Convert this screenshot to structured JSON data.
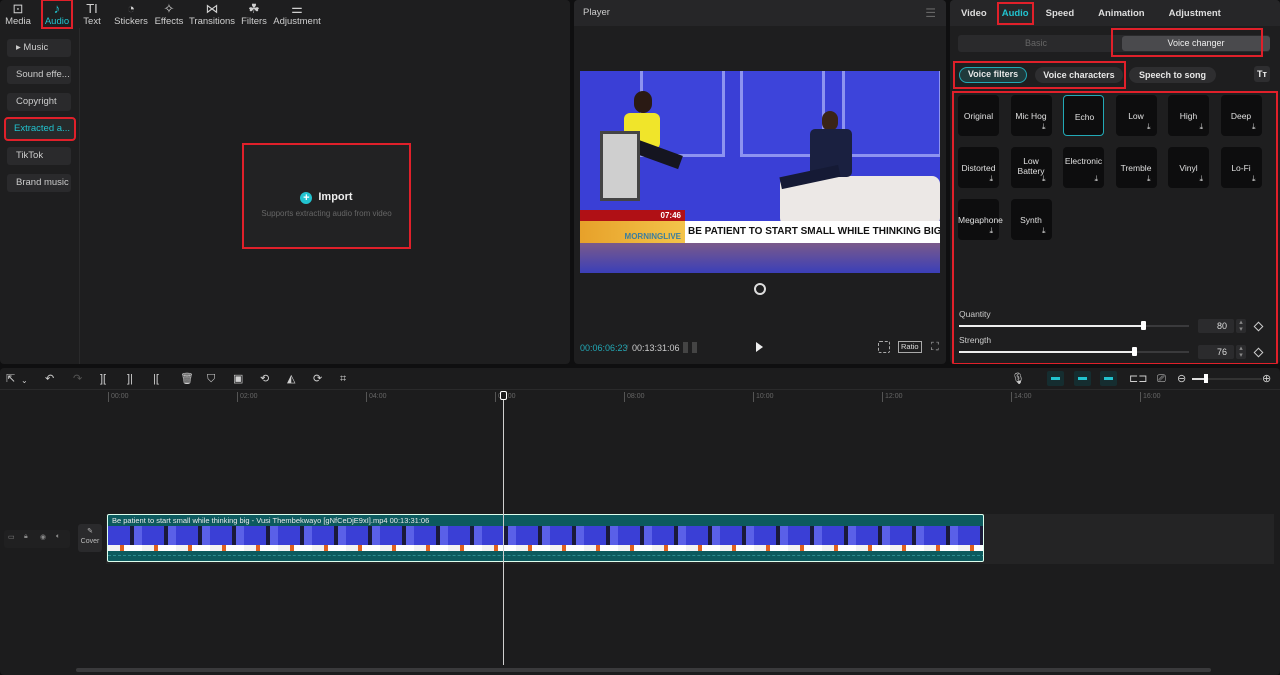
{
  "top_tabs": [
    {
      "label": "Media",
      "icon": "media-icon",
      "glyph": "⊡"
    },
    {
      "label": "Audio",
      "icon": "audio-icon",
      "glyph": "♪"
    },
    {
      "label": "Text",
      "icon": "text-icon",
      "glyph": "TI"
    },
    {
      "label": "Stickers",
      "icon": "stickers-icon",
      "glyph": "◔"
    },
    {
      "label": "Effects",
      "icon": "effects-icon",
      "glyph": "✧"
    },
    {
      "label": "Transitions",
      "icon": "transitions-icon",
      "glyph": "⋈"
    },
    {
      "label": "Filters",
      "icon": "filters-icon",
      "glyph": "☘"
    },
    {
      "label": "Adjustment",
      "icon": "adjustment-icon",
      "glyph": "⚌"
    }
  ],
  "sidebar": {
    "items": [
      {
        "label": "▸ Music"
      },
      {
        "label": "Sound effe..."
      },
      {
        "label": "Copyright"
      },
      {
        "label": "Extracted a..."
      },
      {
        "label": "TikTok"
      },
      {
        "label": "Brand music"
      }
    ]
  },
  "import": {
    "label": "Import",
    "subtitle": "Supports extracting audio from video"
  },
  "player": {
    "title": "Player",
    "current_time": "00:06:06:23",
    "separator": "/",
    "total_time": "00:13:31:06",
    "ratio_label": "Ratio",
    "video": {
      "ticker_time": "07:46",
      "logo": "MORNINGLIVE",
      "headline": "BE PATIENT TO START SMALL WHILE THINKING BIG"
    }
  },
  "props": {
    "tabs": [
      "Video",
      "Audio",
      "Speed",
      "Animation",
      "Adjustment"
    ],
    "active_tab": "Audio",
    "segment": {
      "basic": "Basic",
      "voice_changer": "Voice changer"
    },
    "pills": [
      "Voice filters",
      "Voice characters",
      "Speech to song"
    ],
    "tt_icon": "Tт",
    "filters": [
      {
        "name": "Original",
        "download": false
      },
      {
        "name": "Mic Hog",
        "download": true
      },
      {
        "name": "Echo",
        "download": false,
        "selected": true
      },
      {
        "name": "Low",
        "download": true
      },
      {
        "name": "High",
        "download": true
      },
      {
        "name": "Deep",
        "download": true
      },
      {
        "name": "Distorted",
        "download": true
      },
      {
        "name": "Low Battery",
        "download": true
      },
      {
        "name": "Electronic",
        "download": true
      },
      {
        "name": "Tremble",
        "download": true
      },
      {
        "name": "Vinyl",
        "download": true
      },
      {
        "name": "Lo-Fi",
        "download": true
      },
      {
        "name": "Megaphone",
        "download": true
      },
      {
        "name": "Synth",
        "download": true
      }
    ],
    "download_glyph": "⤓",
    "sliders": [
      {
        "label": "Quantity",
        "value": "80",
        "percent": 80
      },
      {
        "label": "Strength",
        "value": "76",
        "percent": 76
      }
    ]
  },
  "timeline": {
    "ruler": [
      "00:00",
      "02:00",
      "04:00",
      "06:00",
      "08:00",
      "10:00",
      "12:00",
      "14:00",
      "16:00"
    ],
    "clip": {
      "title": "Be patient to start small while thinking big - Vusi Thembekwayo [gNfCeDjE9xI].mp4   00:13:31:06"
    },
    "cover_label": "Cover",
    "zoom_percent": 20
  },
  "colors": {
    "accent": "#22c3cf",
    "highlight": "#e0202a",
    "clip": "#0c5a5e"
  }
}
